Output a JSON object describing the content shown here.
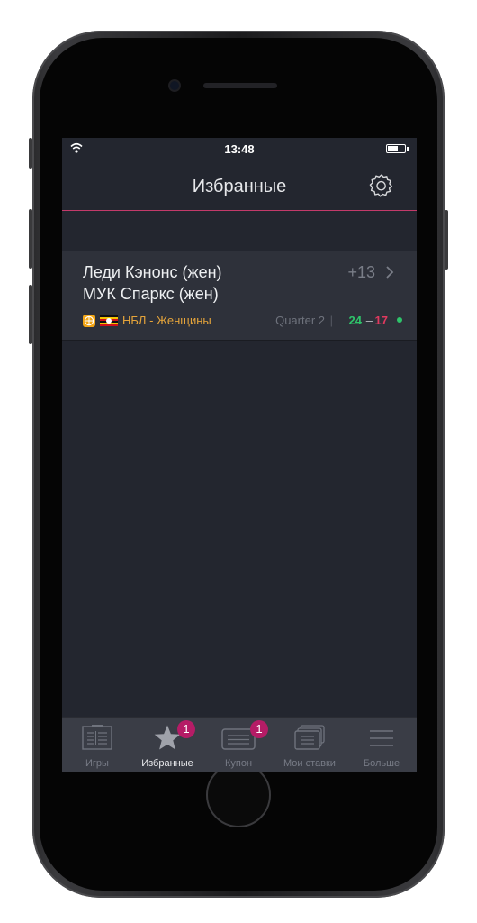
{
  "status_bar": {
    "time": "13:48"
  },
  "header": {
    "title": "Избранные"
  },
  "event": {
    "team_home": "Леди Кэнонс (жен)",
    "team_away": "МУК Спаркс (жен)",
    "markets_count": "+13",
    "league": "НБЛ - Женщины",
    "period": "Quarter 2",
    "separator": "|",
    "score_home": "24",
    "score_dash": "–",
    "score_away": "17"
  },
  "tabbar": {
    "tabs": [
      {
        "label": "Игры",
        "icon": "games-icon"
      },
      {
        "label": "Избранные",
        "icon": "star-icon",
        "badge": "1",
        "active": true
      },
      {
        "label": "Купон",
        "icon": "coupon-icon",
        "badge": "1"
      },
      {
        "label": "Мои ставки",
        "icon": "my-bets-icon"
      },
      {
        "label": "Больше",
        "icon": "menu-icon"
      }
    ]
  },
  "colors": {
    "accent": "#c33a6a",
    "badge": "#b51c66",
    "league": "#e5a43a",
    "score_home": "#2ec46a",
    "score_away": "#e0395f",
    "background": "#23262f",
    "card": "#2e313a",
    "tabbar": "#3a3d46"
  }
}
